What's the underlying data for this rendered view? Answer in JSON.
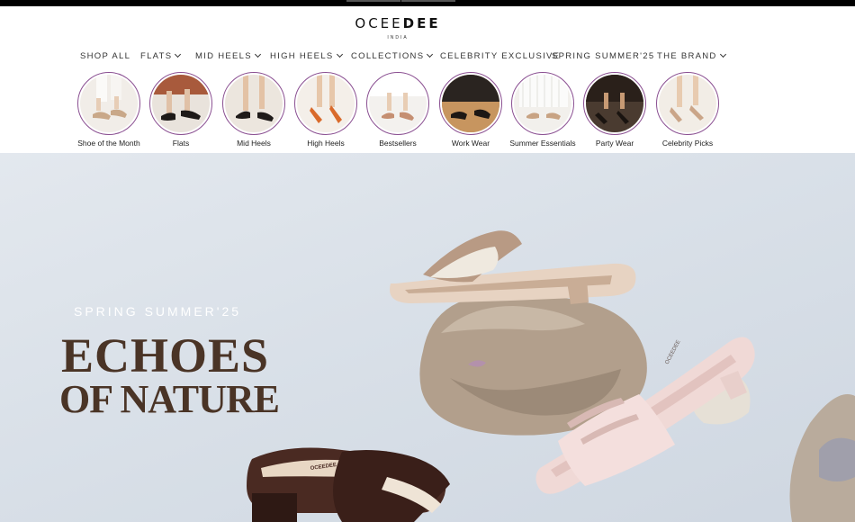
{
  "logo": {
    "part1": "OCEE",
    "part2": "DEE",
    "sub": "INDIA"
  },
  "nav": [
    {
      "label": "SHOP ALL",
      "dropdown": false
    },
    {
      "label": "FLATS",
      "dropdown": true
    },
    {
      "label": "MID HEELS",
      "dropdown": true
    },
    {
      "label": "HIGH HEELS",
      "dropdown": true
    },
    {
      "label": "COLLECTIONS",
      "dropdown": true
    },
    {
      "label": "CELEBRITY EXCLUSIVE",
      "dropdown": false
    },
    {
      "label": "SPRING SUMMER'25",
      "dropdown": false
    },
    {
      "label": "THE BRAND",
      "dropdown": true
    }
  ],
  "categories": [
    {
      "label": "Shoe of the Month",
      "bg": "#f1ede8",
      "accent": "#c9a889"
    },
    {
      "label": "Flats",
      "bg": "#e9e3dc",
      "accent": "#1e1a18"
    },
    {
      "label": "Mid Heels",
      "bg": "#ece6de",
      "accent": "#1f1b19"
    },
    {
      "label": "High Heels",
      "bg": "#f4efe9",
      "accent": "#d96a2b"
    },
    {
      "label": "Bestsellers",
      "bg": "#f3f1ee",
      "accent": "#c58f72"
    },
    {
      "label": "Work Wear",
      "bg": "#b3865a",
      "accent": "#1c1714"
    },
    {
      "label": "Summer Essentials",
      "bg": "#f2f0ec",
      "accent": "#c8a383"
    },
    {
      "label": "Party Wear",
      "bg": "#4a3b30",
      "accent": "#1a1410"
    },
    {
      "label": "Celebrity Picks",
      "bg": "#f2ede6",
      "accent": "#caa588"
    }
  ],
  "hero": {
    "season": "SPRING SUMMER'25",
    "title_line1": "ECHOES",
    "title_line2": "OF NATURE",
    "sandal_brand": "OCEEDEE"
  },
  "colors": {
    "accent_ring": "#8a4f91",
    "hero_title": "#4a3426",
    "hero_bg": "#dbe2ea"
  }
}
